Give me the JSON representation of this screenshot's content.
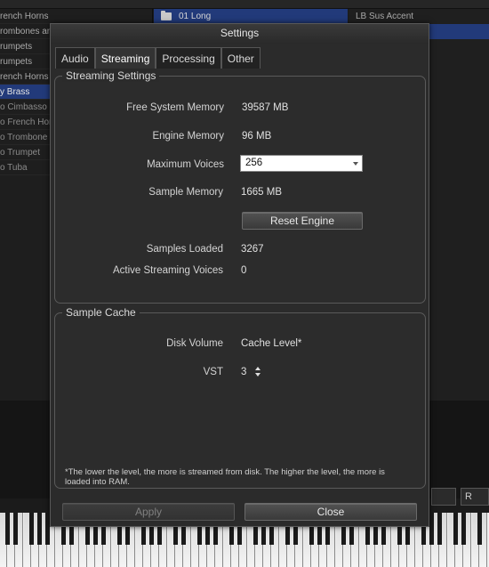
{
  "background": {
    "instrument_list": [
      "rench Horns",
      "rombones ar",
      "rumpets",
      "rumpets",
      "rench Horns",
      "y Brass",
      "o Cimbasso",
      "o French Hor",
      "o Trombone",
      "o Trumpet",
      "o Tuba"
    ],
    "selected_index": 5,
    "folder_label": "01 Long",
    "right_list_item": "LB Sus Accent",
    "bottom_right_button": "R"
  },
  "dialog": {
    "title": "Settings",
    "tabs": [
      {
        "label": "Audio"
      },
      {
        "label": "Streaming"
      },
      {
        "label": "Processing"
      },
      {
        "label": "Other"
      }
    ],
    "active_tab": "Streaming",
    "streaming": {
      "legend": "Streaming Settings",
      "free_system_memory": {
        "label": "Free System Memory",
        "value": "39587 MB"
      },
      "engine_memory": {
        "label": "Engine Memory",
        "value": "96 MB"
      },
      "maximum_voices": {
        "label": "Maximum Voices",
        "value": "256"
      },
      "sample_memory": {
        "label": "Sample Memory",
        "value": "1665 MB"
      },
      "reset_button": "Reset Engine",
      "samples_loaded": {
        "label": "Samples Loaded",
        "value": "3267"
      },
      "active_streaming_voices": {
        "label": "Active Streaming Voices",
        "value": "0"
      }
    },
    "cache": {
      "legend": "Sample Cache",
      "header_label": "Disk Volume",
      "header_value": "Cache Level*",
      "rows": [
        {
          "volume": "VST",
          "level": "3"
        }
      ],
      "note": "*The lower the level, the more is streamed from disk. The higher the level, the more is loaded into RAM."
    },
    "apply_button": "Apply",
    "close_button": "Close"
  }
}
